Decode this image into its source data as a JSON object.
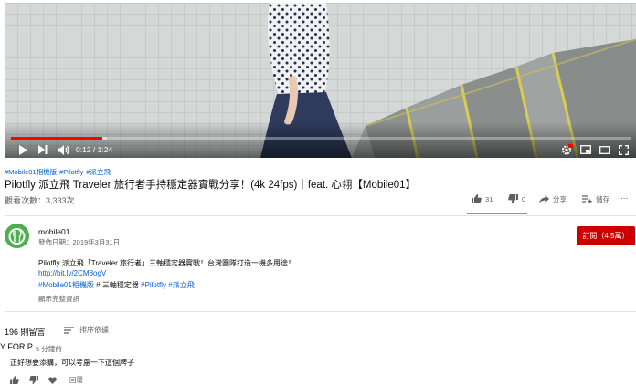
{
  "player": {
    "current_time": "0:12",
    "duration": "1:24",
    "time_separator": "/",
    "progress": 0.148,
    "buffered": 0.155,
    "icons": [
      "play-icon",
      "next-icon",
      "volume-icon",
      "settings-icon",
      "miniplayer-icon",
      "theater-icon",
      "fullscreen-icon"
    ],
    "accent_color": "#ff0000",
    "hd_badge_color": "#ff0000"
  },
  "video": {
    "hashtags": [
      "#Mobile01相機版",
      "#Pilotfly",
      "#派立飛"
    ],
    "title": "Pilotfly 派立飛 Traveler 旅行者手持穩定器實戰分享！(4k 24fps)｜feat. 心翎【Mobile01】",
    "views": "觀看次數：3,333次",
    "likes": "31",
    "dislikes": "0",
    "share_label": "分享",
    "save_label": "儲存",
    "more_label": "..."
  },
  "channel": {
    "name": "mobile01",
    "publish_date": "發佈日期：2019年3月31日",
    "subscribe_label": "訂閱（4.5萬）",
    "avatar_color": "#4caf50",
    "subscribe_color": "#cc0000"
  },
  "description": {
    "line1": "Pilotfly 派立飛「Traveler 旅行者」三軸穩定器實戰！台灣團隊打造一機多用途！",
    "link": "http://bit.ly/2CM8ogV",
    "line3_tags": "#Mobile01相機版",
    "line3_mid": " # 三軸穩定器 ",
    "line3_tag2": "#Pilotfly",
    "line3_tag3": "#派立飛",
    "show_more": "顯示完整資訊"
  },
  "comments": {
    "count": "196 則留言",
    "sort_label": "排序依據",
    "items": [
      {
        "author": "Y FOR P",
        "time": "5 分鐘前",
        "text": "正好想要添購，可以考慮一下這個牌子",
        "reply_label": "回覆"
      }
    ]
  }
}
